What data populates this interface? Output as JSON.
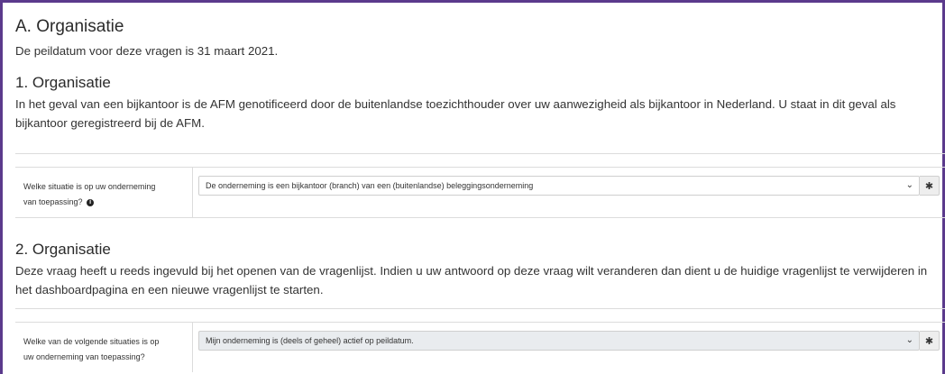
{
  "sectionA": {
    "title": "A. Organisatie",
    "intro": "De peildatum voor deze vragen is 31 maart 2021."
  },
  "q1": {
    "title": "1. Organisatie",
    "text": "In het geval van een bijkantoor is de AFM genotificeerd door de buitenlandse toezichthouder over uw aanwezigheid als bijkantoor in Nederland. U staat in dit geval als bijkantoor geregistreerd bij de AFM.",
    "label_line1": "Welke situatie is op uw onderneming",
    "label_line2": "van toepassing?",
    "info_icon_glyph": "i",
    "select_value": "De onderneming is een bijkantoor (branch) van een (buitenlandse) beleggingsonderneming",
    "required_symbol": "✱"
  },
  "q2": {
    "title": "2. Organisatie",
    "text": "Deze vraag heeft u reeds ingevuld bij het openen van de vragenlijst. Indien u uw antwoord op deze vraag wilt veranderen dan dient u de huidige vragenlijst te verwijderen in het dashboardpagina en een nieuwe vragenlijst te starten.",
    "label_line1": "Welke van de volgende situaties is op",
    "label_line2": "uw onderneming van toepassing?",
    "select_value": "Mijn onderneming is (deels of geheel) actief op peildatum.",
    "required_symbol": "✱"
  },
  "icons": {
    "chevron": "chevron-down-icon",
    "required": "asterisk-icon",
    "info": "info-circle-icon"
  },
  "colors": {
    "frame_border": "#5b3a8c",
    "disabled_field": "#e9ecef"
  }
}
